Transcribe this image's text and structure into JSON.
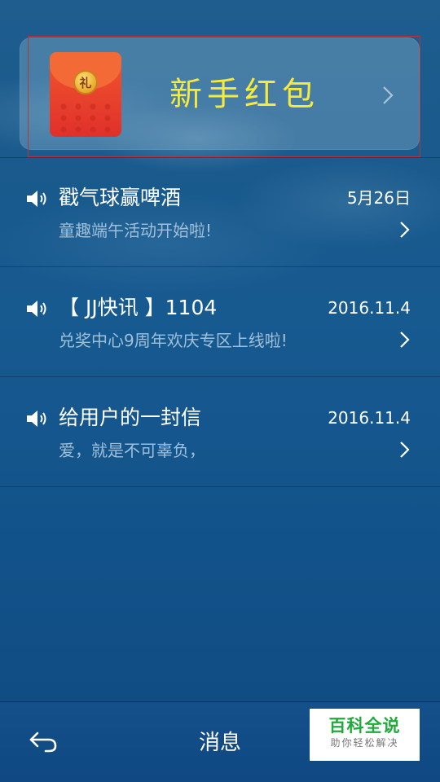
{
  "banner": {
    "title": "新手红包",
    "packet_seal": "礼",
    "chevron_icon": "chevron-right-icon",
    "packet_icon": "red-envelope-icon"
  },
  "messages": [
    {
      "title": "戳气球赢啤酒",
      "date": "5月26日",
      "subtitle": "童趣端午活动开始啦!",
      "icon": "speaker-icon"
    },
    {
      "title": "【 JJ快讯 】1104",
      "date": "2016.11.4",
      "subtitle": "兑奖中心9周年欢庆专区上线啦!",
      "icon": "speaker-icon"
    },
    {
      "title": "给用户的一封信",
      "date": "2016.11.4",
      "subtitle": "爱，就是不可辜负，",
      "icon": "speaker-icon"
    }
  ],
  "bottom_bar": {
    "title": "消息",
    "back_icon": "back-arrow-icon"
  },
  "watermark": {
    "main": "百科全说",
    "sub": "助你轻松解决"
  },
  "colors": {
    "accent_yellow": "#f6ea3c",
    "packet_red": "#e0302a",
    "background_blue": "#175a90",
    "subtitle_text": "#9fc0da",
    "watermark_green": "#1fab3c"
  }
}
